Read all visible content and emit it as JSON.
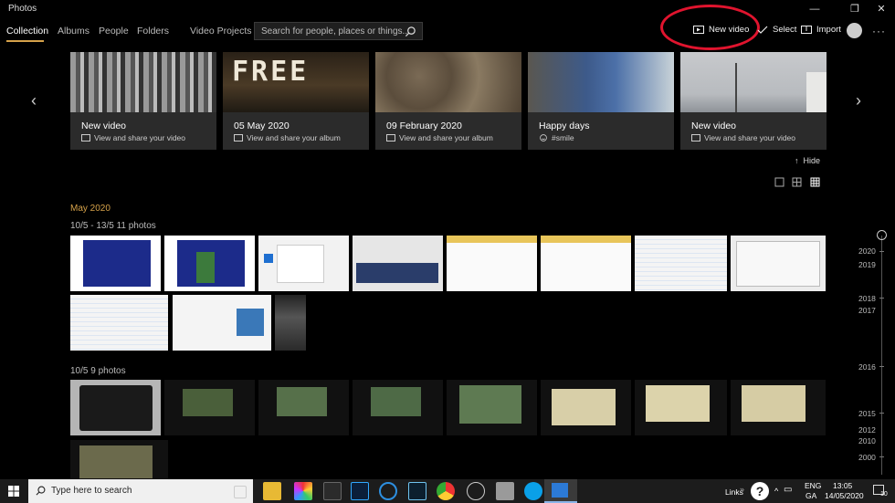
{
  "window": {
    "title": "Photos",
    "minimize": "—",
    "restore": "❐",
    "close": "✕"
  },
  "nav": {
    "tabs": [
      "Collection",
      "Albums",
      "People",
      "Folders",
      "Video Projects"
    ]
  },
  "search": {
    "placeholder": "Search for people, places or things..."
  },
  "commands": {
    "new_video": "New video",
    "select": "Select",
    "import": "Import",
    "more": "···"
  },
  "cards": [
    {
      "title": "New video",
      "subtitle": "View and share your video",
      "icon": "video-icon"
    },
    {
      "title": "05 May 2020",
      "subtitle": "View and share your album",
      "icon": "album-icon",
      "overlay_text": "FREE"
    },
    {
      "title": "09 February 2020",
      "subtitle": "View and share your album",
      "icon": "album-icon"
    },
    {
      "title": "Happy days",
      "subtitle": "#smile",
      "icon": "smile-icon"
    },
    {
      "title": "New video",
      "subtitle": "View and share your video",
      "icon": "video-icon"
    }
  ],
  "hide_label": "Hide",
  "collection": {
    "month": "May 2020",
    "groups": [
      {
        "label": "10/5 - 13/5   11 photos"
      },
      {
        "label": "10/5   9 photos"
      }
    ]
  },
  "timeline": {
    "years": [
      "2020",
      "2019",
      "2018",
      "2017",
      "2016",
      "2015",
      "2012",
      "2010",
      "2000"
    ]
  },
  "taskbar": {
    "search_text": "Type here to search",
    "links": "Links",
    "lang_top": "ENG",
    "lang_bottom": "GA",
    "time": "13:05",
    "date": "14/05/2020",
    "notification_count": "10"
  }
}
